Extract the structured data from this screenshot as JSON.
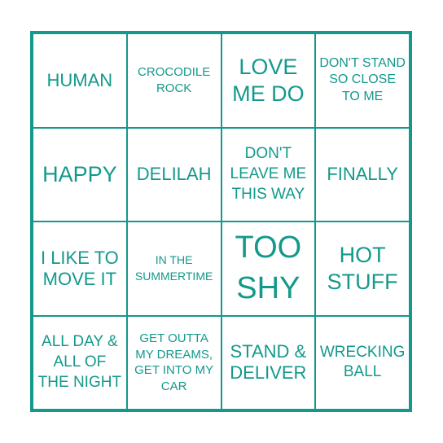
{
  "card": {
    "accent_color": "#13998b",
    "cells": [
      {
        "text": "HUMAN",
        "size": "s-m"
      },
      {
        "text": "CROCODILE ROCK",
        "size": "s-xs"
      },
      {
        "text": "LOVE ME DO",
        "size": "s-l"
      },
      {
        "text": "DON'T STAND SO CLOSE TO ME",
        "size": "s-s"
      },
      {
        "text": "HAPPY",
        "size": "s-l"
      },
      {
        "text": "DELILAH",
        "size": "s-m"
      },
      {
        "text": "DON'T LEAVE ME THIS WAY",
        "size": "s-md"
      },
      {
        "text": "FINALLY",
        "size": "s-m"
      },
      {
        "text": "I LIKE TO MOVE IT",
        "size": "s-m"
      },
      {
        "text": "IN THE SUMMERTIME",
        "size": "s-xxs"
      },
      {
        "text": "TOO SHY",
        "size": "s-xl"
      },
      {
        "text": "HOT STUFF",
        "size": "s-l"
      },
      {
        "text": "ALL DAY & ALL OF THE NIGHT",
        "size": "s-md"
      },
      {
        "text": "GET OUTTA MY DREAMS, GET INTO MY CAR",
        "size": "s-xs"
      },
      {
        "text": "STAND & DELIVER",
        "size": "s-m"
      },
      {
        "text": "WRECKING BALL",
        "size": "s-md"
      }
    ]
  }
}
